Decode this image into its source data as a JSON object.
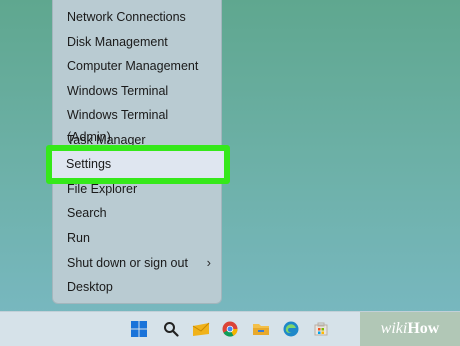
{
  "menu": {
    "items": [
      {
        "label": "Network Connections"
      },
      {
        "label": "Disk Management"
      },
      {
        "label": "Computer Management"
      },
      {
        "label": "Windows Terminal"
      },
      {
        "label": "Windows Terminal (Admin)"
      },
      {
        "label": "Task Manager"
      },
      {
        "label": "Settings"
      },
      {
        "label": "File Explorer"
      },
      {
        "label": "Search"
      },
      {
        "label": "Run"
      },
      {
        "label": "Shut down or sign out"
      },
      {
        "label": "Desktop"
      }
    ],
    "submenu_arrow": "›"
  },
  "highlight": {
    "color": "#35e81a"
  },
  "taskbar": {
    "icons": [
      "windows-start-icon",
      "search-icon",
      "mail-icon",
      "chrome-icon",
      "file-explorer-icon",
      "edge-icon",
      "store-icon"
    ]
  },
  "watermark": {
    "wiki": "wiki",
    "how": "How"
  }
}
